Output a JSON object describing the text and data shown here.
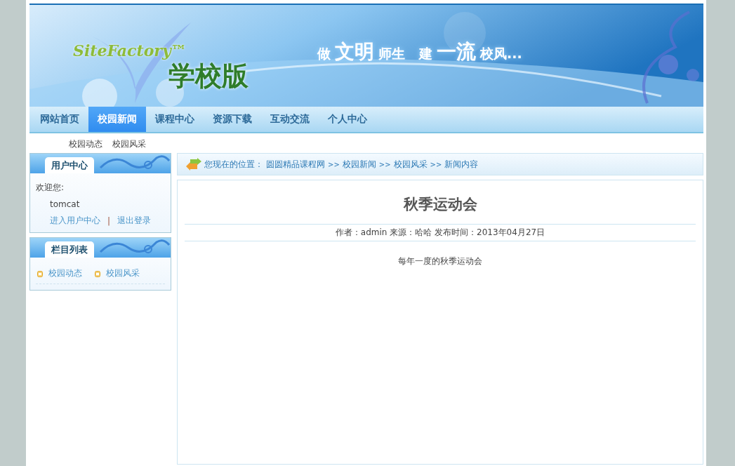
{
  "banner": {
    "logo_text": "SiteFactory™",
    "edition": "学校版",
    "slogan": [
      {
        "text": "做",
        "big": false
      },
      {
        "text": "文明",
        "big": true
      },
      {
        "text": "师生",
        "big": false
      },
      {
        "text": "建",
        "big": false
      },
      {
        "text": "一流",
        "big": true
      },
      {
        "text": "校风...",
        "big": false
      }
    ]
  },
  "nav": [
    {
      "label": "网站首页",
      "selected": false
    },
    {
      "label": "校园新闻",
      "selected": true
    },
    {
      "label": "课程中心",
      "selected": false
    },
    {
      "label": "资源下载",
      "selected": false
    },
    {
      "label": "互动交流",
      "selected": false
    },
    {
      "label": "个人中心",
      "selected": false
    }
  ],
  "subnav": [
    "校园动态",
    "校园风采"
  ],
  "user_panel": {
    "title": "用户中心",
    "welcome": "欢迎您:",
    "username": "tomcat",
    "links": [
      "进入用户中心",
      "退出登录"
    ],
    "separator": "|"
  },
  "category_panel": {
    "title": "栏目列表",
    "items": [
      "校园动态",
      "校园风采"
    ]
  },
  "breadcrumb": {
    "label": "您现在的位置：",
    "items": [
      "圆圆精品课程网",
      ">>",
      "校园新闻",
      ">>",
      "校园风采",
      ">>",
      "新闻内容"
    ]
  },
  "article": {
    "title": "秋季运动会",
    "meta": "作者：admin 来源：哈哈 发布时间：2013年04月27日",
    "body": "每年一度的秋季运动会"
  }
}
